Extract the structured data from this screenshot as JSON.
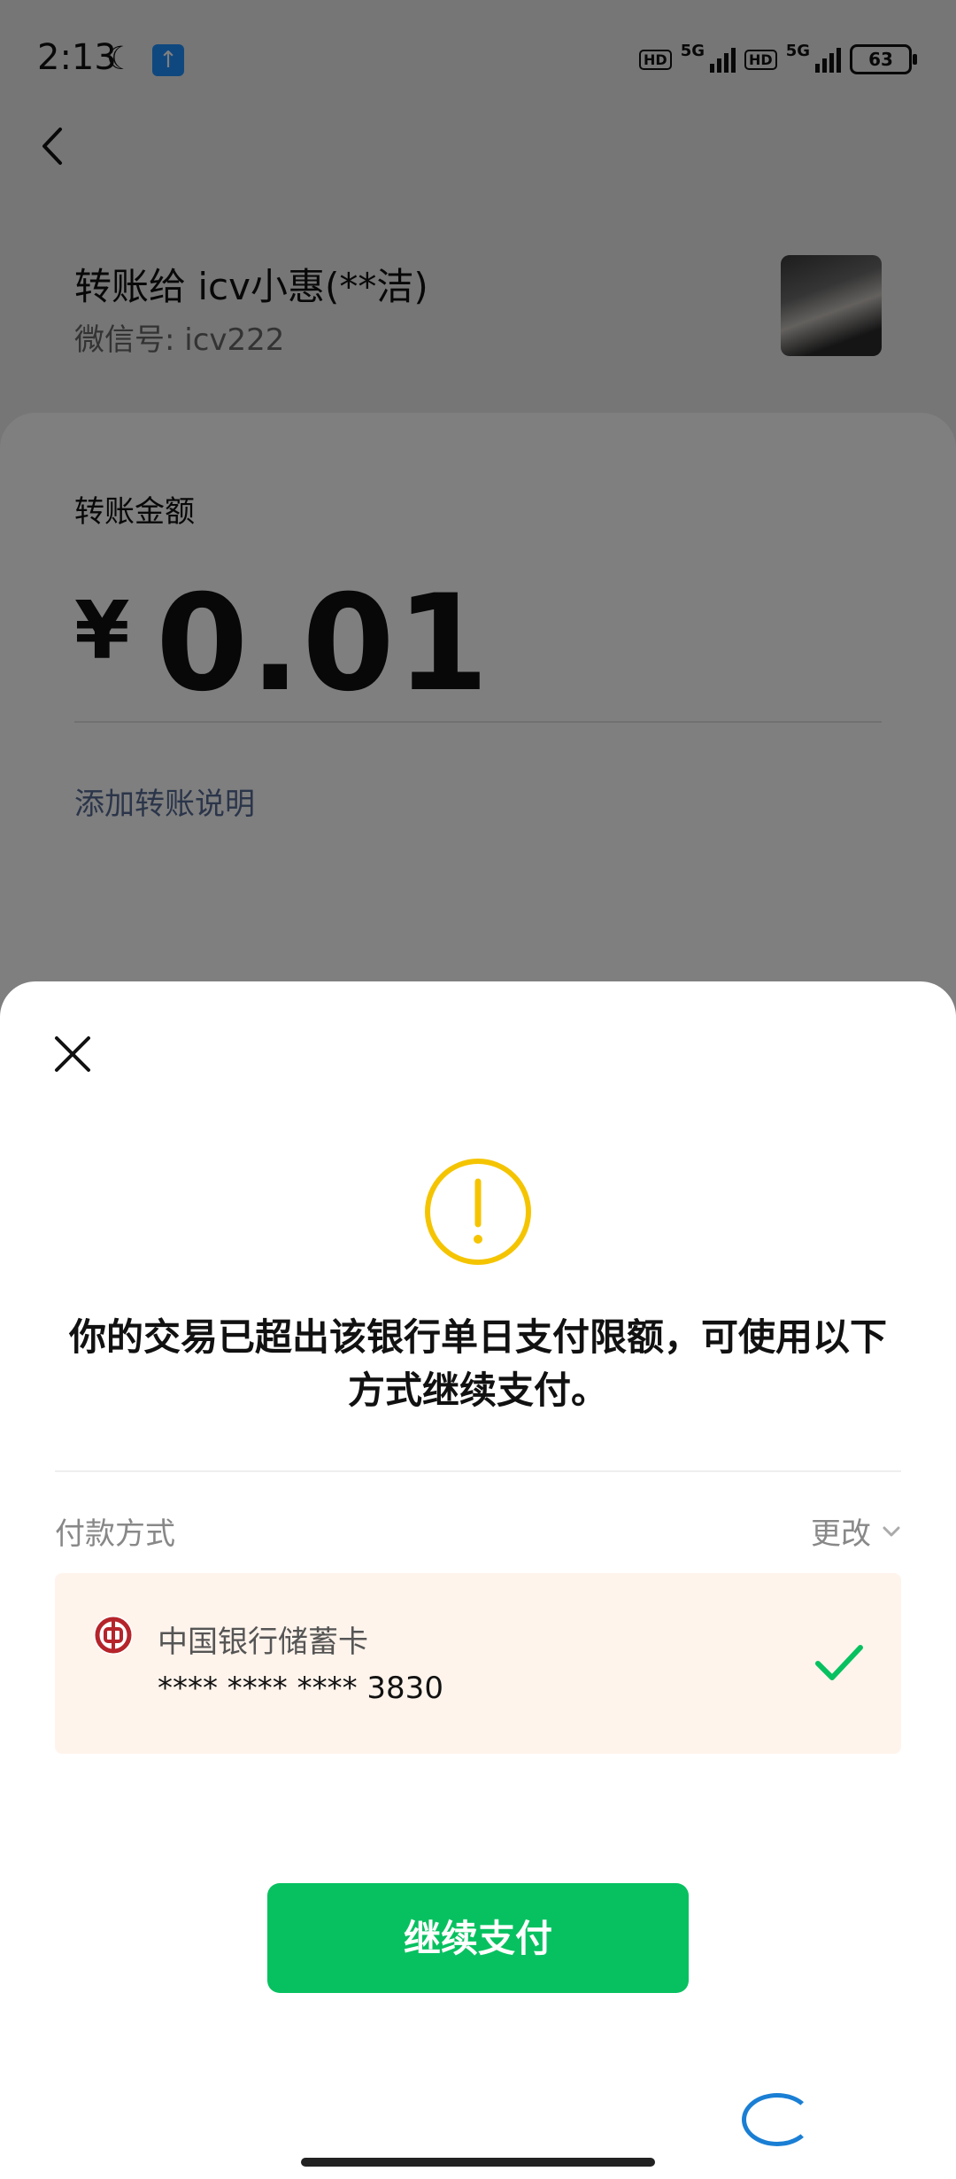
{
  "status_bar": {
    "time": "2:13",
    "net1": "5G",
    "net2": "5G",
    "hd1": "HD",
    "hd2": "HD",
    "battery": "63"
  },
  "header": {
    "title": "转账给 icv小惠(**洁)",
    "wechat_id": "微信号: icv222"
  },
  "amount": {
    "label": "转账金额",
    "currency": "¥",
    "value": "0.01",
    "add_note": "添加转账说明"
  },
  "dialog": {
    "message": "你的交易已超出该银行单日支付限额，可使用以下方式继续支付。",
    "payment_label": "付款方式",
    "change_label": "更改",
    "card": {
      "name": "中国银行储蓄卡",
      "number": "**** **** **** 3830"
    },
    "continue_button": "继续支付"
  },
  "colors": {
    "accent_green": "#07c160",
    "warning_yellow": "#f5c400",
    "link_blue": "#576b95",
    "card_bg": "#fff4ec"
  }
}
